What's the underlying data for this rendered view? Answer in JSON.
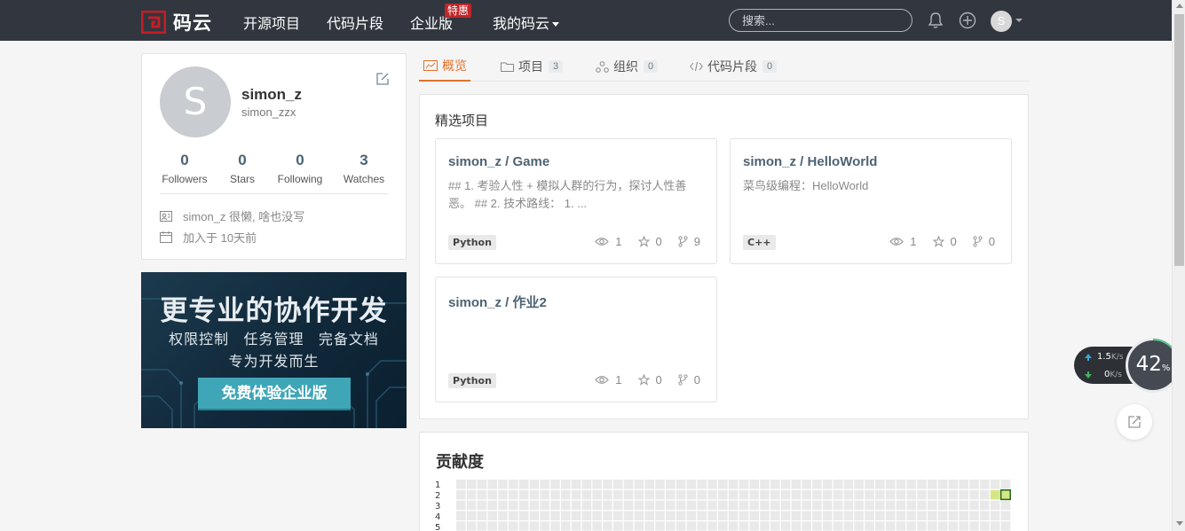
{
  "header": {
    "logo_text": "码云",
    "nav": [
      "开源项目",
      "代码片段",
      "企业版",
      "我的码云"
    ],
    "badge": "特惠",
    "search_placeholder": "搜索...",
    "user_initial": "S"
  },
  "profile": {
    "initial": "S",
    "name": "simon_z",
    "username": "simon_zzx",
    "stats": [
      {
        "value": "0",
        "label": "Followers"
      },
      {
        "value": "0",
        "label": "Stars"
      },
      {
        "value": "0",
        "label": "Following"
      },
      {
        "value": "3",
        "label": "Watches"
      }
    ],
    "bio": "simon_z 很懒, 啥也没写",
    "joined": "加入于 10天前"
  },
  "banner": {
    "title": "更专业的协作开发",
    "subtitle": "权限控制   任务管理   完备文档",
    "subtitle2": "专为开发而生",
    "button": "免费体验企业版"
  },
  "tabs": [
    {
      "label": "概览"
    },
    {
      "label": "项目",
      "count": "3"
    },
    {
      "label": "组织",
      "count": "0"
    },
    {
      "label": "代码片段",
      "count": "0"
    }
  ],
  "featured": {
    "title": "精选项目",
    "repos": [
      {
        "name": "simon_z / Game",
        "desc": "## 1. 考验人性 + 模拟人群的行为，探讨人性善恶。 ## 2. 技术路线： 1. ...",
        "lang": "Python",
        "watch": "1",
        "star": "0",
        "fork": "9"
      },
      {
        "name": "simon_z / HelloWorld",
        "desc": "菜鸟级编程：HelloWorld",
        "lang": "C++",
        "watch": "1",
        "star": "0",
        "fork": "0"
      },
      {
        "name": "simon_z / 作业2",
        "desc": "",
        "lang": "Python",
        "watch": "1",
        "star": "0",
        "fork": "0"
      }
    ]
  },
  "contribution": {
    "title": "贡献度",
    "row_labels": [
      "1",
      "2",
      "3",
      "4",
      "5"
    ]
  },
  "widgets": {
    "upload_speed": "1.5",
    "upload_unit": "K/s",
    "download_speed": "0",
    "download_unit": "K/s",
    "gauge_value": "42",
    "gauge_unit": "%"
  }
}
